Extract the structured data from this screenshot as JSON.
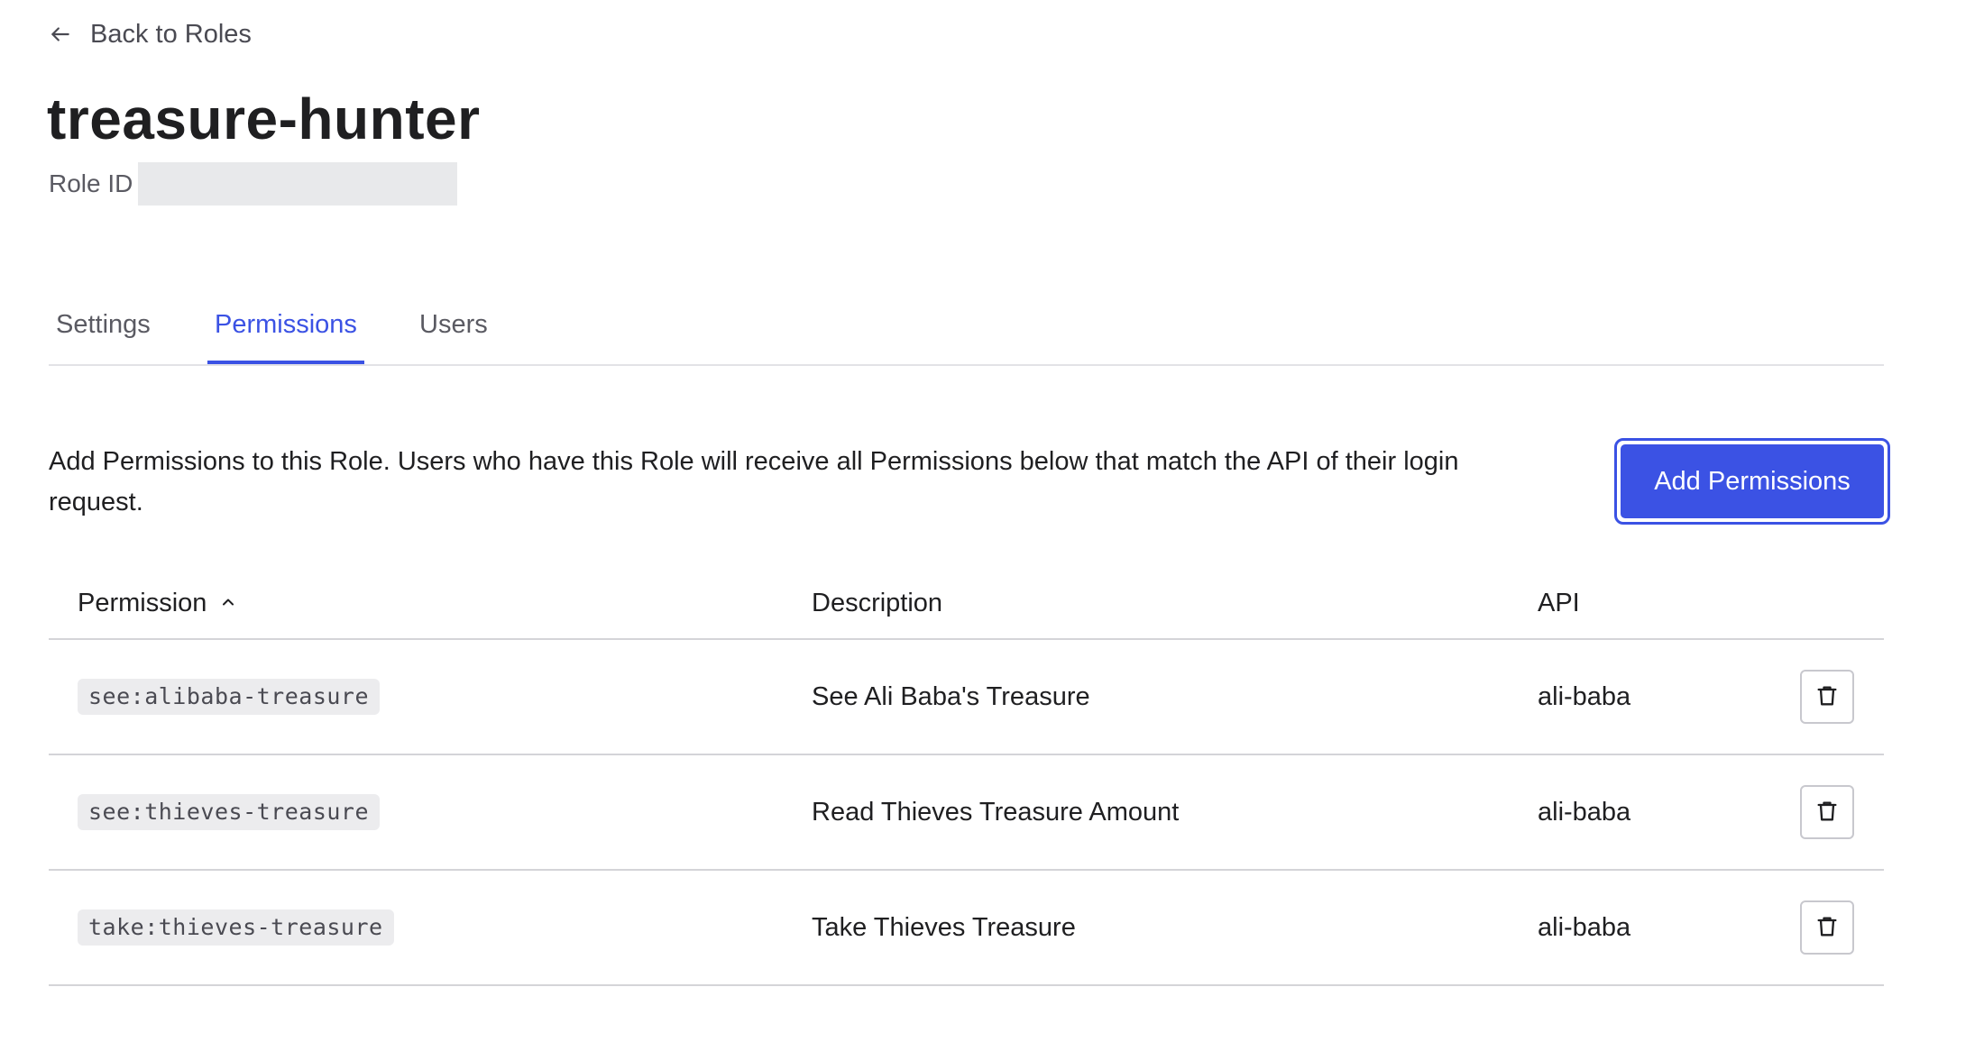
{
  "back_link": {
    "icon": "arrow-left-icon",
    "label": "Back to Roles"
  },
  "role": {
    "name": "treasure-hunter",
    "id_label": "Role ID",
    "id_value": ""
  },
  "tabs": [
    {
      "label": "Settings",
      "active": false
    },
    {
      "label": "Permissions",
      "active": true
    },
    {
      "label": "Users",
      "active": false
    }
  ],
  "permissions_section": {
    "intro": "Add Permissions to this Role. Users who have this Role will receive all Permissions below that match the API of their login request.",
    "add_button_label": "Add Permissions"
  },
  "table": {
    "headers": {
      "permission": "Permission",
      "description": "Description",
      "api": "API"
    },
    "sort": {
      "column": "permission",
      "direction": "ascending",
      "icon": "chevron-up-icon"
    },
    "rows": [
      {
        "permission": "see:alibaba-treasure",
        "description": "See Ali Baba's Treasure",
        "api": "ali-baba",
        "action_icon": "trash-icon"
      },
      {
        "permission": "see:thieves-treasure",
        "description": "Read Thieves Treasure Amount",
        "api": "ali-baba",
        "action_icon": "trash-icon"
      },
      {
        "permission": "take:thieves-treasure",
        "description": "Take Thieves Treasure",
        "api": "ali-baba",
        "action_icon": "trash-icon"
      }
    ]
  },
  "colors": {
    "accent": "#3b52e4",
    "text": "#1f1f21",
    "muted_text": "#5a5a62",
    "divider": "#d4d4d8",
    "code_background": "#ececee"
  }
}
